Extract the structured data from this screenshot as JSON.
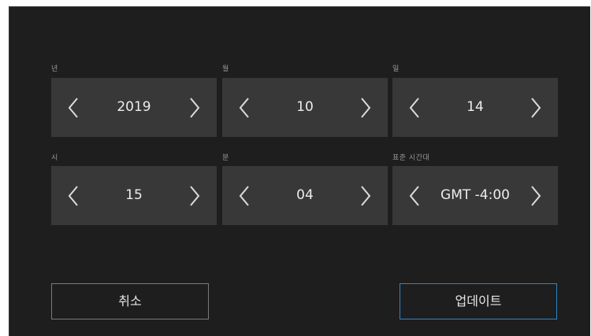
{
  "date": {
    "year": {
      "label": "년",
      "value": "2019"
    },
    "month": {
      "label": "월",
      "value": "10"
    },
    "day": {
      "label": "일",
      "value": "14"
    }
  },
  "time": {
    "hour": {
      "label": "시",
      "value": "15"
    },
    "minute": {
      "label": "분",
      "value": "04"
    },
    "timezone": {
      "label": "표준 시간대",
      "value": "GMT -4:00"
    }
  },
  "buttons": {
    "cancel_label": "취소",
    "update_label": "업데이트"
  },
  "icons": {
    "decrement": "chevron-left-icon",
    "increment": "chevron-right-icon"
  },
  "colors": {
    "background": "#1e1e1e",
    "stepper": "#383838",
    "text": "#ececec",
    "label": "#9a9a9a",
    "update_border": "#2f86c6",
    "cancel_border": "#7a7a7a"
  }
}
